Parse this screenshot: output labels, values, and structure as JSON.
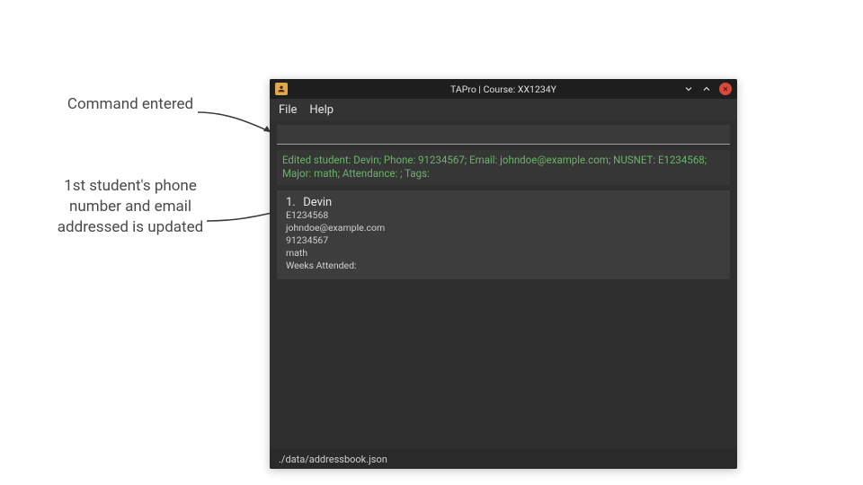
{
  "annotations": {
    "top": "Command entered",
    "mid": "1st student's phone number and email addressed is updated"
  },
  "titlebar": {
    "title": "TAPro | Course: XX1234Y"
  },
  "menubar": {
    "file": "File",
    "help": "Help"
  },
  "command_input": {
    "value": "",
    "placeholder": ""
  },
  "result_text": "Edited student: Devin; Phone: 91234567; Email: johndoe@example.com; NUSNET: E1234568; Major: math; Attendance: ; Tags:",
  "students": [
    {
      "index": "1.",
      "name": "Devin",
      "nusnet": "E1234568",
      "email": "johndoe@example.com",
      "phone": "91234567",
      "major": "math",
      "weeks_label": "Weeks Attended:"
    }
  ],
  "status_path": "./data/addressbook.json"
}
